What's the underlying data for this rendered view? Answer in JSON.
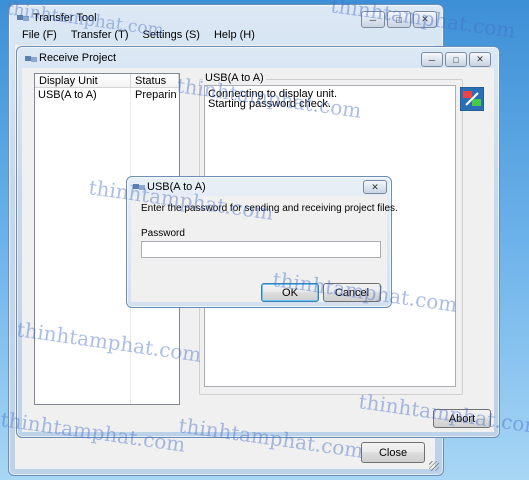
{
  "transfer_window": {
    "title": "Transfer Tool",
    "menu": [
      "File (F)",
      "Transfer (T)",
      "Settings (S)",
      "Help (H)"
    ],
    "close_button": "Close",
    "abort_button": "Abort"
  },
  "receive_window": {
    "title": "Receive Project",
    "list_headers": [
      "Display Unit",
      "Status"
    ],
    "list_rows": [
      {
        "unit": "USB(A to A)",
        "status": "Preparin..."
      }
    ],
    "group_title": "USB(A to A)",
    "log_lines": [
      "Connecting to display unit.",
      "Starting password check."
    ]
  },
  "dialog": {
    "title": "USB(A to A)",
    "message": "Enter the password for sending and receiving project files.",
    "password_label": "Password",
    "password_value": "",
    "ok_label": "OK",
    "cancel_label": "Cancel"
  },
  "watermarks": [
    "thinhtamphat.com",
    "thinhtamphat.com",
    "thinhtamphat.com",
    "thinhtamphat.com",
    "thinhtamphat.com",
    "thinhtamphat.com",
    "thinhtamphat.com",
    "thinhtamphat.com",
    "thinhtamphat.com"
  ],
  "colors": {
    "desktop": "#3d8fd6",
    "window_frame": "#c6d8ec",
    "client": "#f0f0f0"
  }
}
